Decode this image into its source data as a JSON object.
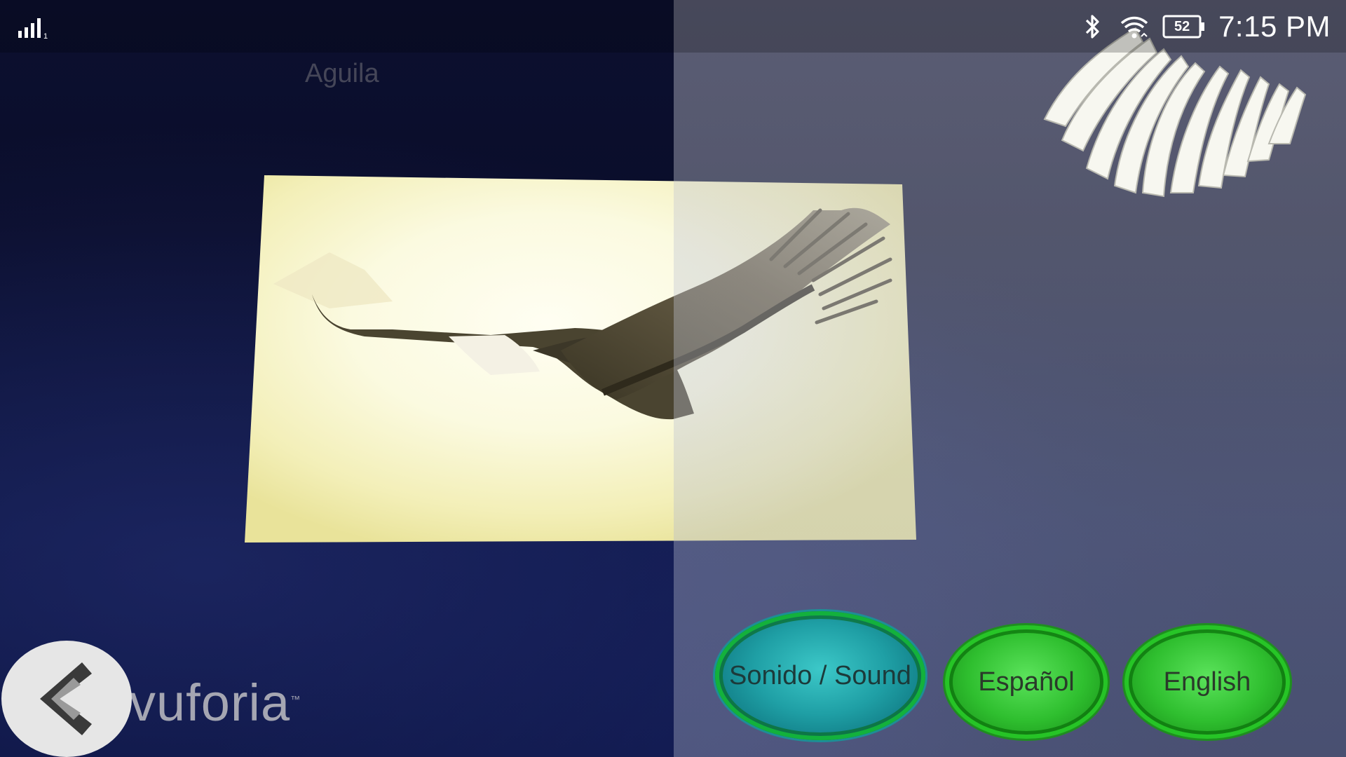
{
  "status_bar": {
    "signal_icon": "signal-bars-icon",
    "bluetooth_icon": "bluetooth-icon",
    "wifi_icon": "wifi-icon",
    "battery_level": "52",
    "time": "7:15 PM"
  },
  "ar_view": {
    "model_label": "Aguila",
    "watermark": "vuforia",
    "watermark_mark": "™"
  },
  "buttons": {
    "sound_label": "Sonido / Sound",
    "spanish_label": "Español",
    "english_label": "English",
    "back_icon": "chevron-left-icon"
  },
  "colors": {
    "sound_button": "#1f9fa5",
    "language_button": "#2fbf2f",
    "back_button": "#e6e6e6"
  }
}
